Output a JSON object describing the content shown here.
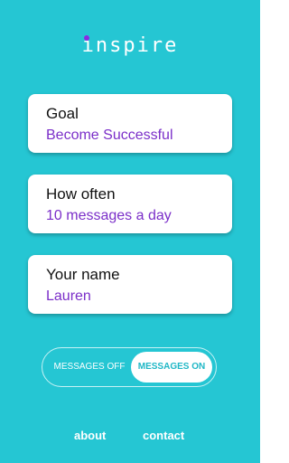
{
  "app": {
    "logo_text": "inspire"
  },
  "cards": [
    {
      "label": "Goal",
      "value": "Become Successful"
    },
    {
      "label": "How often",
      "value": "10 messages a day"
    },
    {
      "label": "Your name",
      "value": "Lauren"
    }
  ],
  "toggle": {
    "off_label": "MESSAGES OFF",
    "on_label": "MESSAGES ON",
    "selected": "on"
  },
  "footer": {
    "about_label": "about",
    "contact_label": "contact"
  },
  "colors": {
    "background": "#25c6d3",
    "accent_purple": "#7b2fc9",
    "toggle_on_text": "#1fb7c6"
  }
}
